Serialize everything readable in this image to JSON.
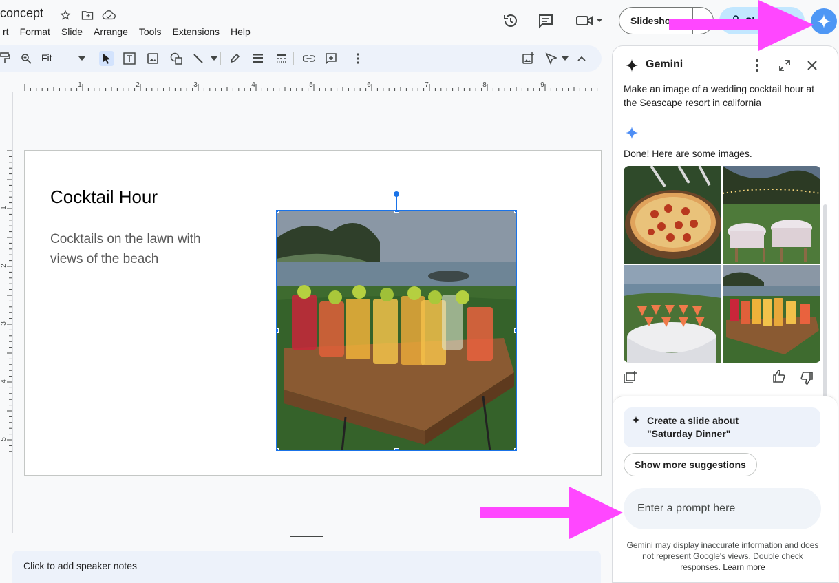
{
  "doc": {
    "title": "concept"
  },
  "menu": [
    "rt",
    "Format",
    "Slide",
    "Arrange",
    "Tools",
    "Extensions",
    "Help"
  ],
  "header": {
    "slideshow_label": "Slideshow",
    "share_label": "Sh"
  },
  "toolbar": {
    "zoom_value": "Fit"
  },
  "slide": {
    "title": "Cocktail Hour",
    "body": "Cocktails on the lawn with views of the beach"
  },
  "ruler": {
    "h": [
      "1",
      "2",
      "3",
      "4",
      "5",
      "6",
      "7",
      "8",
      "9"
    ],
    "v": [
      "1",
      "2",
      "3",
      "4",
      "5"
    ]
  },
  "notes": {
    "placeholder": "Click to add speaker notes"
  },
  "gemini": {
    "title": "Gemini",
    "user_prompt": "Make an image of a wedding cocktail hour at the Seascape resort in california",
    "response": "Done! Here are some images.",
    "images": [
      "pizza-image",
      "reception-tables-image",
      "beach-cocktail-table-image",
      "cocktails-on-wood-table-image"
    ],
    "suggestion_line1": "Create a slide about",
    "suggestion_line2": "\"Saturday Dinner\"",
    "show_more": "Show more suggestions",
    "prompt_placeholder": "Enter a prompt here",
    "disclaimer": "Gemini may display inaccurate information and does not represent Google's views. Double check responses.",
    "learn_more": "Learn more"
  },
  "colors": {
    "accent": "#1a73e8",
    "arrow": "#ff47ff",
    "gemini_button": "#4e97f5",
    "share": "#c2e7ff"
  }
}
